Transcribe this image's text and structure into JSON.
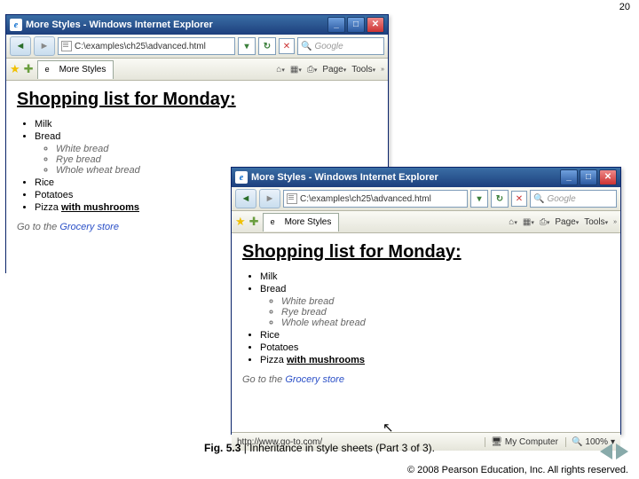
{
  "pageNumber": "20",
  "windowA": {
    "title": "More Styles - Windows Internet Explorer",
    "address": "C:\\examples\\ch25\\advanced.html",
    "searchPlaceholder": "Google",
    "tabTitle": "More Styles",
    "toolbar": {
      "page": "Page",
      "tools": "Tools"
    },
    "page": {
      "heading": "Shopping list for Monday:",
      "items": [
        "Milk",
        "Bread",
        "Rice",
        "Potatoes"
      ],
      "breadSub": [
        "White bread",
        "Rye bread",
        "Whole wheat bread"
      ],
      "pizzaPrefix": "Pizza ",
      "pizzaEm": "with mushrooms",
      "gotoPrefix": "Go to the ",
      "gotoLink": "Grocery store"
    }
  },
  "windowB": {
    "title": "More Styles - Windows Internet Explorer",
    "address": "C:\\examples\\ch25\\advanced.html",
    "searchPlaceholder": "Google",
    "tabTitle": "More Styles",
    "toolbar": {
      "page": "Page",
      "tools": "Tools"
    },
    "page": {
      "heading": "Shopping list for Monday:",
      "items": [
        "Milk",
        "Bread",
        "Rice",
        "Potatoes"
      ],
      "breadSub": [
        "White bread",
        "Rye bread",
        "Whole wheat bread"
      ],
      "pizzaPrefix": "Pizza ",
      "pizzaEm": "with mushrooms",
      "gotoPrefix": "Go to the ",
      "gotoLink": "Grocery store"
    },
    "status": {
      "url": "http://www.go-to.com/",
      "zone": "My Computer",
      "zoom": "100%"
    }
  },
  "caption": {
    "label": "Fig. 5.3",
    "sep": " | ",
    "text": "Inheritance in style sheets (Part 3 of 3)."
  },
  "copyright": "© 2008 Pearson Education, Inc.  All rights reserved."
}
